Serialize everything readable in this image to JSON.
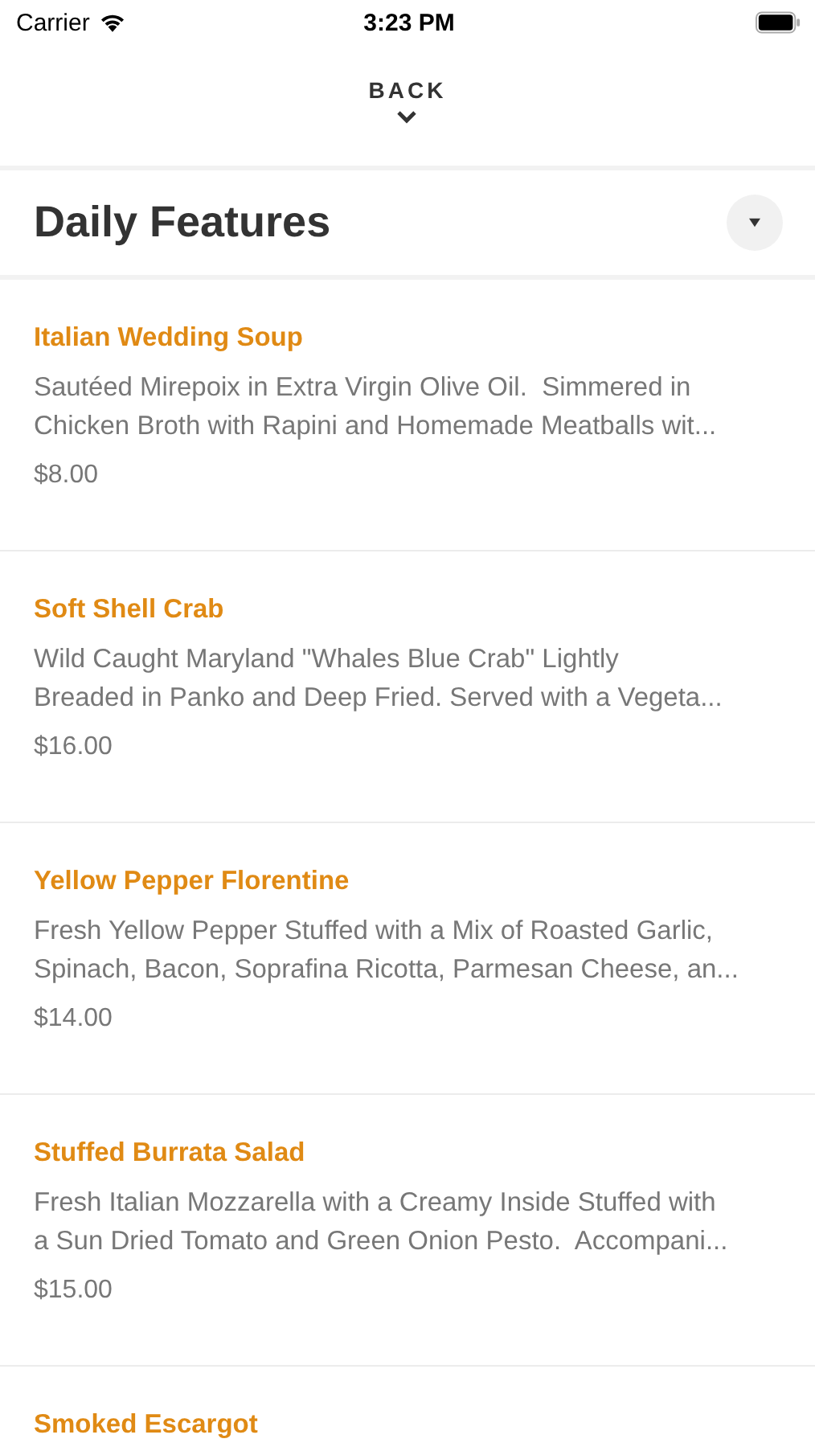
{
  "status_bar": {
    "carrier": "Carrier",
    "time": "3:23 PM"
  },
  "nav": {
    "back": "BACK"
  },
  "section": {
    "title": "Daily Features",
    "expanded": true
  },
  "items": [
    {
      "name": "Italian Wedding Soup",
      "description": [
        "Sautéed Mirepoix in Extra Virgin Olive Oil.  Simmered in",
        "Chicken Broth with Rapini and Homemade Meatballs wit..."
      ],
      "price": "$8.00"
    },
    {
      "name": "Soft Shell Crab",
      "description": [
        "Wild Caught Maryland \"Whales Blue Crab\" Lightly",
        "Breaded in Panko and Deep Fried. Served with a Vegeta..."
      ],
      "price": "$16.00"
    },
    {
      "name": "Yellow Pepper Florentine",
      "description": [
        "Fresh Yellow Pepper Stuffed with a Mix of Roasted Garlic,",
        "Spinach, Bacon, Soprafina Ricotta, Parmesan Cheese, an..."
      ],
      "price": "$14.00"
    },
    {
      "name": "Stuffed Burrata Salad",
      "description": [
        "Fresh Italian Mozzarella with a Creamy Inside Stuffed with",
        "a Sun Dried Tomato and Green Onion Pesto.  Accompani..."
      ],
      "price": "$15.00"
    },
    {
      "name": "Smoked Escargot"
    }
  ]
}
